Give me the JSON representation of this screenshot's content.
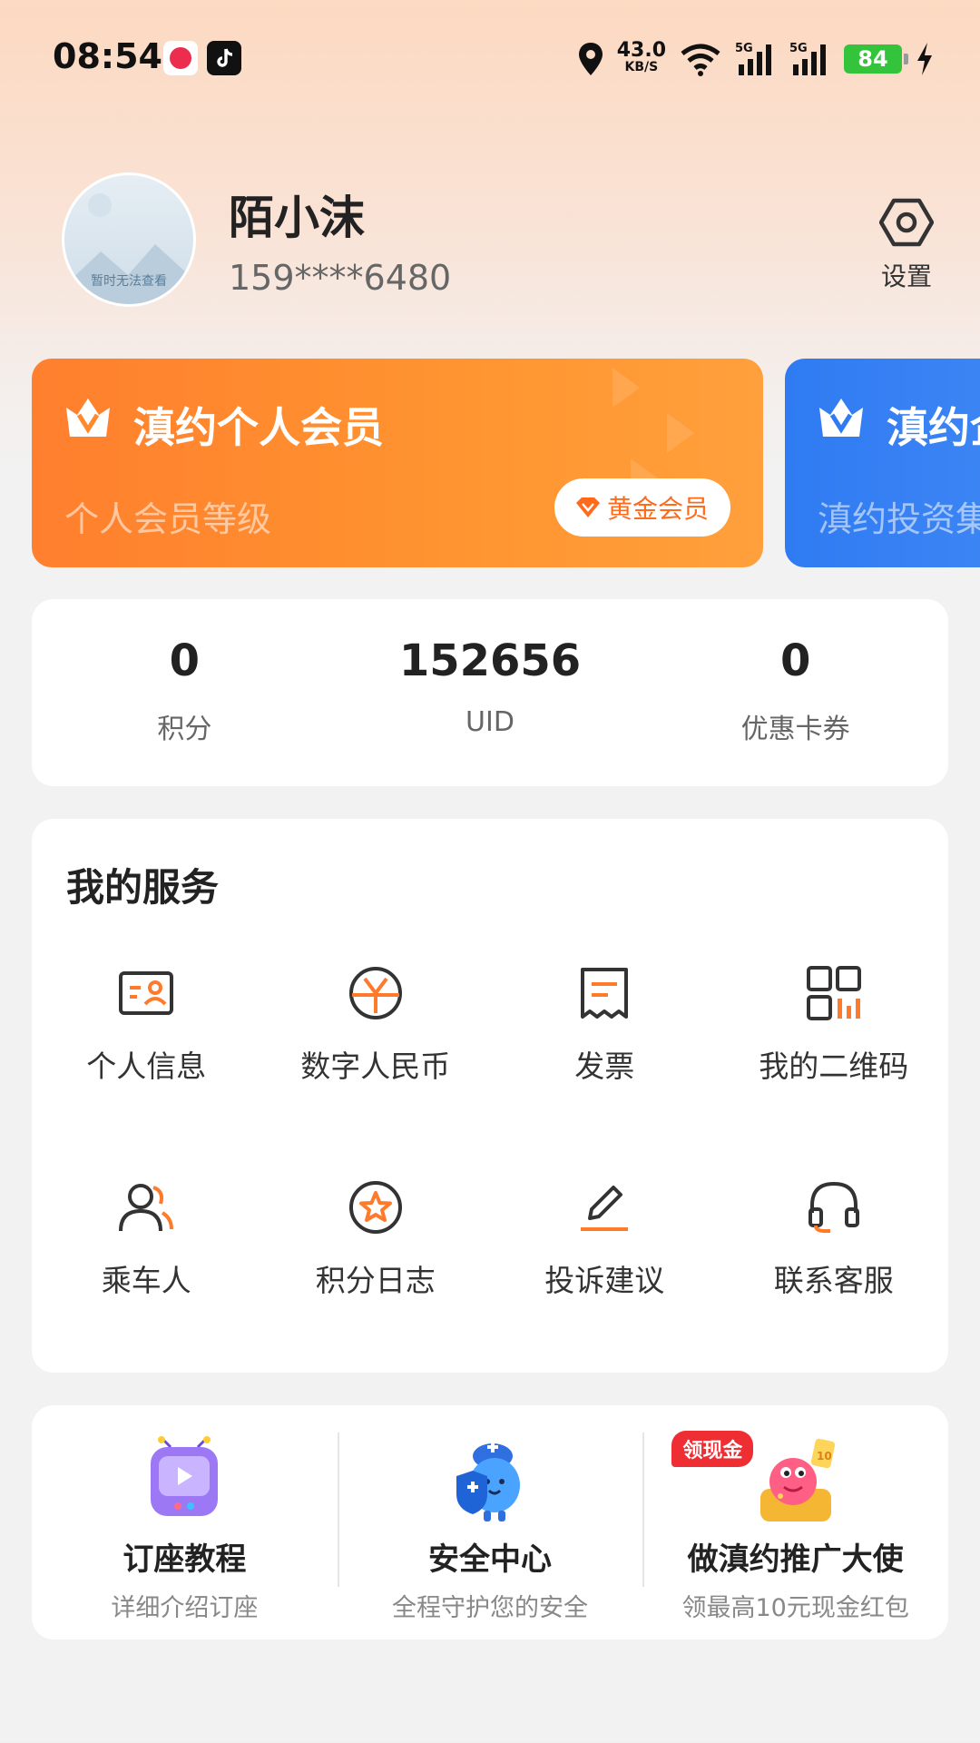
{
  "status_bar": {
    "time": "08:54",
    "net_speed": "43.0",
    "net_unit": "KB/S",
    "signal_1": "5G",
    "signal_2": "5G",
    "battery": "84"
  },
  "profile": {
    "avatar_placeholder": "暂时无法查看",
    "name": "陌小沫",
    "phone": "159****6480",
    "settings_label": "设置"
  },
  "member_cards": [
    {
      "title": "滇约个人会员",
      "subtitle": "个人会员等级",
      "badge": "黄金会员",
      "color": "#ff8a2e"
    },
    {
      "title": "滇约企业会员",
      "subtitle": "滇约投资集团",
      "color": "#2f7bf2"
    }
  ],
  "stats": [
    {
      "value": "0",
      "label": "积分"
    },
    {
      "value": "152656",
      "label": "UID"
    },
    {
      "value": "0",
      "label": "优惠卡券"
    }
  ],
  "services": {
    "title": "我的服务",
    "items": [
      {
        "label": "个人信息",
        "icon": "id-card-icon"
      },
      {
        "label": "数字人民币",
        "icon": "yuan-icon"
      },
      {
        "label": "发票",
        "icon": "receipt-icon"
      },
      {
        "label": "我的二维码",
        "icon": "qr-code-icon"
      },
      {
        "label": "乘车人",
        "icon": "passengers-icon"
      },
      {
        "label": "积分日志",
        "icon": "star-circle-icon"
      },
      {
        "label": "投诉建议",
        "icon": "pen-icon"
      },
      {
        "label": "联系客服",
        "icon": "headset-icon"
      }
    ]
  },
  "promo": [
    {
      "title": "订座教程",
      "desc": "详细介绍订座",
      "art": "tv-mascot"
    },
    {
      "title": "安全中心",
      "desc": "全程守护您的安全",
      "art": "shield-mascot"
    },
    {
      "title": "做滇约推广大使",
      "desc": "领最高10元现金红包",
      "tag": "领现金",
      "art": "red-mascot"
    }
  ],
  "colors": {
    "accent": "#ff7a2a",
    "blue": "#2f7bf2"
  }
}
